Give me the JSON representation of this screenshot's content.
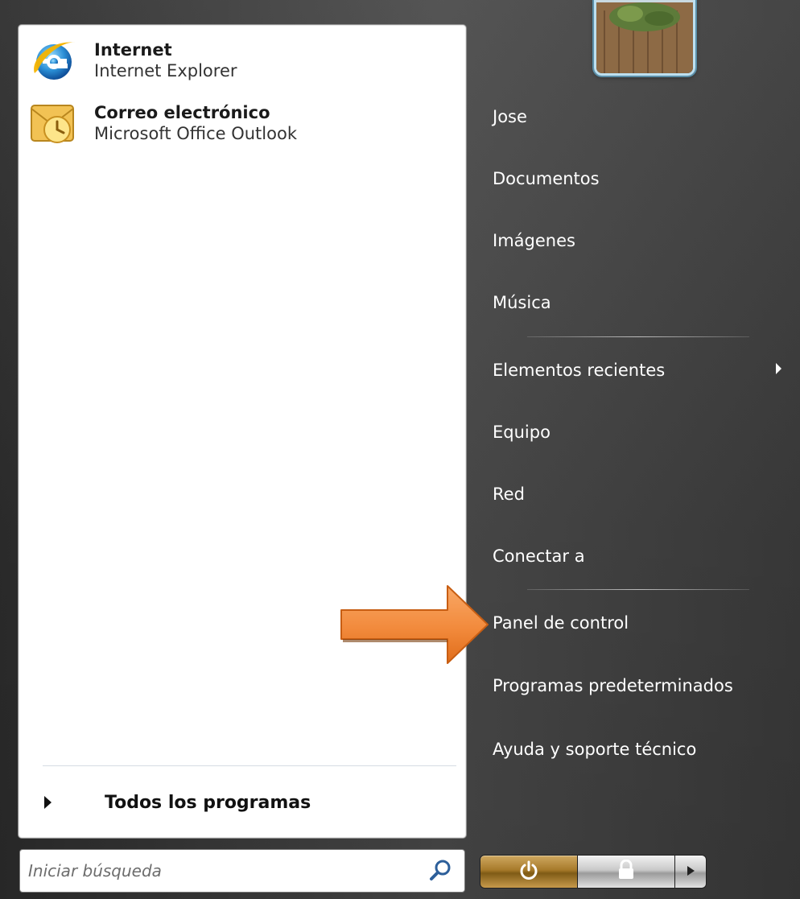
{
  "pinned": [
    {
      "title": "Internet",
      "subtitle": "Internet Explorer",
      "icon": "internet-explorer-icon"
    },
    {
      "title": "Correo electrónico",
      "subtitle": "Microsoft Office Outlook",
      "icon": "outlook-icon"
    }
  ],
  "all_programs_label": "Todos los programas",
  "search": {
    "placeholder": "Iniciar búsqueda",
    "icon": "search-icon"
  },
  "right_items": {
    "user": "Jose",
    "documents": "Documentos",
    "pictures": "Imágenes",
    "music": "Música",
    "recent": "Elementos recientes",
    "computer": "Equipo",
    "network": "Red",
    "connect": "Conectar a",
    "control_panel": "Panel de control",
    "default_programs": "Programas predeterminados",
    "help": "Ayuda y soporte técnico"
  },
  "power_buttons": {
    "power": "power-icon",
    "lock": "lock-icon",
    "more": "arrow-right-icon"
  },
  "colors": {
    "highlight_arrow": "#f28a3c",
    "menu_bg": "#3d3d3d"
  }
}
